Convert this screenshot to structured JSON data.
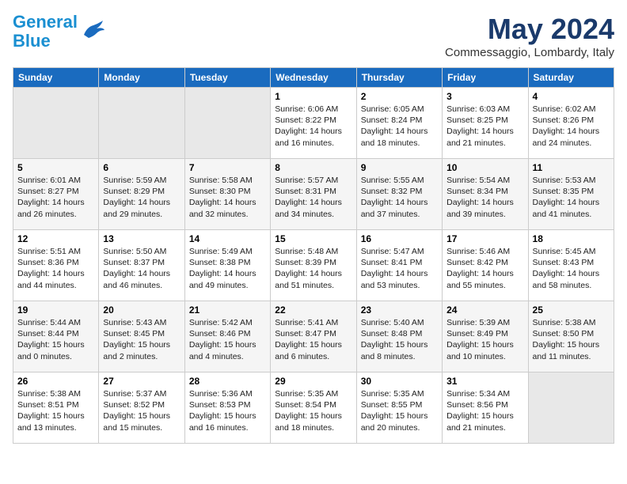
{
  "header": {
    "logo_line1": "General",
    "logo_line2": "Blue",
    "month": "May 2024",
    "location": "Commessaggio, Lombardy, Italy"
  },
  "days_of_week": [
    "Sunday",
    "Monday",
    "Tuesday",
    "Wednesday",
    "Thursday",
    "Friday",
    "Saturday"
  ],
  "weeks": [
    [
      {
        "day": "",
        "sunrise": "",
        "sunset": "",
        "daylight": ""
      },
      {
        "day": "",
        "sunrise": "",
        "sunset": "",
        "daylight": ""
      },
      {
        "day": "",
        "sunrise": "",
        "sunset": "",
        "daylight": ""
      },
      {
        "day": "1",
        "sunrise": "Sunrise: 6:06 AM",
        "sunset": "Sunset: 8:22 PM",
        "daylight": "Daylight: 14 hours and 16 minutes."
      },
      {
        "day": "2",
        "sunrise": "Sunrise: 6:05 AM",
        "sunset": "Sunset: 8:24 PM",
        "daylight": "Daylight: 14 hours and 18 minutes."
      },
      {
        "day": "3",
        "sunrise": "Sunrise: 6:03 AM",
        "sunset": "Sunset: 8:25 PM",
        "daylight": "Daylight: 14 hours and 21 minutes."
      },
      {
        "day": "4",
        "sunrise": "Sunrise: 6:02 AM",
        "sunset": "Sunset: 8:26 PM",
        "daylight": "Daylight: 14 hours and 24 minutes."
      }
    ],
    [
      {
        "day": "5",
        "sunrise": "Sunrise: 6:01 AM",
        "sunset": "Sunset: 8:27 PM",
        "daylight": "Daylight: 14 hours and 26 minutes."
      },
      {
        "day": "6",
        "sunrise": "Sunrise: 5:59 AM",
        "sunset": "Sunset: 8:29 PM",
        "daylight": "Daylight: 14 hours and 29 minutes."
      },
      {
        "day": "7",
        "sunrise": "Sunrise: 5:58 AM",
        "sunset": "Sunset: 8:30 PM",
        "daylight": "Daylight: 14 hours and 32 minutes."
      },
      {
        "day": "8",
        "sunrise": "Sunrise: 5:57 AM",
        "sunset": "Sunset: 8:31 PM",
        "daylight": "Daylight: 14 hours and 34 minutes."
      },
      {
        "day": "9",
        "sunrise": "Sunrise: 5:55 AM",
        "sunset": "Sunset: 8:32 PM",
        "daylight": "Daylight: 14 hours and 37 minutes."
      },
      {
        "day": "10",
        "sunrise": "Sunrise: 5:54 AM",
        "sunset": "Sunset: 8:34 PM",
        "daylight": "Daylight: 14 hours and 39 minutes."
      },
      {
        "day": "11",
        "sunrise": "Sunrise: 5:53 AM",
        "sunset": "Sunset: 8:35 PM",
        "daylight": "Daylight: 14 hours and 41 minutes."
      }
    ],
    [
      {
        "day": "12",
        "sunrise": "Sunrise: 5:51 AM",
        "sunset": "Sunset: 8:36 PM",
        "daylight": "Daylight: 14 hours and 44 minutes."
      },
      {
        "day": "13",
        "sunrise": "Sunrise: 5:50 AM",
        "sunset": "Sunset: 8:37 PM",
        "daylight": "Daylight: 14 hours and 46 minutes."
      },
      {
        "day": "14",
        "sunrise": "Sunrise: 5:49 AM",
        "sunset": "Sunset: 8:38 PM",
        "daylight": "Daylight: 14 hours and 49 minutes."
      },
      {
        "day": "15",
        "sunrise": "Sunrise: 5:48 AM",
        "sunset": "Sunset: 8:39 PM",
        "daylight": "Daylight: 14 hours and 51 minutes."
      },
      {
        "day": "16",
        "sunrise": "Sunrise: 5:47 AM",
        "sunset": "Sunset: 8:41 PM",
        "daylight": "Daylight: 14 hours and 53 minutes."
      },
      {
        "day": "17",
        "sunrise": "Sunrise: 5:46 AM",
        "sunset": "Sunset: 8:42 PM",
        "daylight": "Daylight: 14 hours and 55 minutes."
      },
      {
        "day": "18",
        "sunrise": "Sunrise: 5:45 AM",
        "sunset": "Sunset: 8:43 PM",
        "daylight": "Daylight: 14 hours and 58 minutes."
      }
    ],
    [
      {
        "day": "19",
        "sunrise": "Sunrise: 5:44 AM",
        "sunset": "Sunset: 8:44 PM",
        "daylight": "Daylight: 15 hours and 0 minutes."
      },
      {
        "day": "20",
        "sunrise": "Sunrise: 5:43 AM",
        "sunset": "Sunset: 8:45 PM",
        "daylight": "Daylight: 15 hours and 2 minutes."
      },
      {
        "day": "21",
        "sunrise": "Sunrise: 5:42 AM",
        "sunset": "Sunset: 8:46 PM",
        "daylight": "Daylight: 15 hours and 4 minutes."
      },
      {
        "day": "22",
        "sunrise": "Sunrise: 5:41 AM",
        "sunset": "Sunset: 8:47 PM",
        "daylight": "Daylight: 15 hours and 6 minutes."
      },
      {
        "day": "23",
        "sunrise": "Sunrise: 5:40 AM",
        "sunset": "Sunset: 8:48 PM",
        "daylight": "Daylight: 15 hours and 8 minutes."
      },
      {
        "day": "24",
        "sunrise": "Sunrise: 5:39 AM",
        "sunset": "Sunset: 8:49 PM",
        "daylight": "Daylight: 15 hours and 10 minutes."
      },
      {
        "day": "25",
        "sunrise": "Sunrise: 5:38 AM",
        "sunset": "Sunset: 8:50 PM",
        "daylight": "Daylight: 15 hours and 11 minutes."
      }
    ],
    [
      {
        "day": "26",
        "sunrise": "Sunrise: 5:38 AM",
        "sunset": "Sunset: 8:51 PM",
        "daylight": "Daylight: 15 hours and 13 minutes."
      },
      {
        "day": "27",
        "sunrise": "Sunrise: 5:37 AM",
        "sunset": "Sunset: 8:52 PM",
        "daylight": "Daylight: 15 hours and 15 minutes."
      },
      {
        "day": "28",
        "sunrise": "Sunrise: 5:36 AM",
        "sunset": "Sunset: 8:53 PM",
        "daylight": "Daylight: 15 hours and 16 minutes."
      },
      {
        "day": "29",
        "sunrise": "Sunrise: 5:35 AM",
        "sunset": "Sunset: 8:54 PM",
        "daylight": "Daylight: 15 hours and 18 minutes."
      },
      {
        "day": "30",
        "sunrise": "Sunrise: 5:35 AM",
        "sunset": "Sunset: 8:55 PM",
        "daylight": "Daylight: 15 hours and 20 minutes."
      },
      {
        "day": "31",
        "sunrise": "Sunrise: 5:34 AM",
        "sunset": "Sunset: 8:56 PM",
        "daylight": "Daylight: 15 hours and 21 minutes."
      },
      {
        "day": "",
        "sunrise": "",
        "sunset": "",
        "daylight": ""
      }
    ]
  ]
}
